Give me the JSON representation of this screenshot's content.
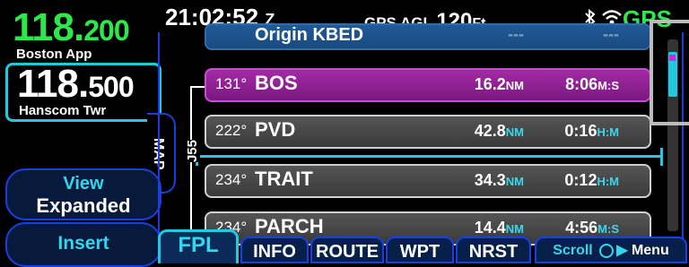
{
  "com": {
    "active": {
      "freq_int": "118.",
      "freq_dec": "200",
      "name": "Boston App"
    },
    "standby": {
      "freq_int": "118.",
      "freq_dec": "500",
      "name": "Hanscom Twr"
    }
  },
  "side": {
    "map_label": "MAP",
    "view_line1": "View",
    "view_line2": "Expanded",
    "insert_label": "Insert"
  },
  "topbar": {
    "time": "21:02:52",
    "time_zone": "Z",
    "agl_label": "GPS AGL",
    "agl_value": "120",
    "agl_unit": "Ft",
    "gps_status": "GPS"
  },
  "route": {
    "airway": "J55",
    "rows": [
      {
        "crs": "",
        "wpt": "Origin KBED",
        "dist": "---",
        "dist_unit": "",
        "ete": "---",
        "ete_unit": "",
        "state": "origin"
      },
      {
        "crs": "131°",
        "wpt": "BOS",
        "dist": "16.2",
        "dist_unit": "NM",
        "ete": "8:06",
        "ete_unit": "M:S",
        "state": "active"
      },
      {
        "crs": "222°",
        "wpt": "PVD",
        "dist": "42.8",
        "dist_unit": "NM",
        "ete": "0:16",
        "ete_unit": "H:M",
        "state": "normal"
      },
      {
        "crs": "234°",
        "wpt": "TRAIT",
        "dist": "34.3",
        "dist_unit": "NM",
        "ete": "0:12",
        "ete_unit": "H:M",
        "state": "normal"
      },
      {
        "crs": "234°",
        "wpt": "PARCH",
        "dist": "14.4",
        "dist_unit": "NM",
        "ete": "4:56",
        "ete_unit": "M:S",
        "state": "normal"
      }
    ]
  },
  "tabs": {
    "items": [
      "FPL",
      "INFO",
      "ROUTE",
      "WPT",
      "NRST"
    ],
    "selected": "FPL",
    "scroll_label": "Scroll",
    "menu_label": "Menu"
  },
  "colors": {
    "accent": "#22c8e0",
    "active_leg": "#a42aa6",
    "frequency": "#2ee84a",
    "frame": "#1a3fe0"
  }
}
